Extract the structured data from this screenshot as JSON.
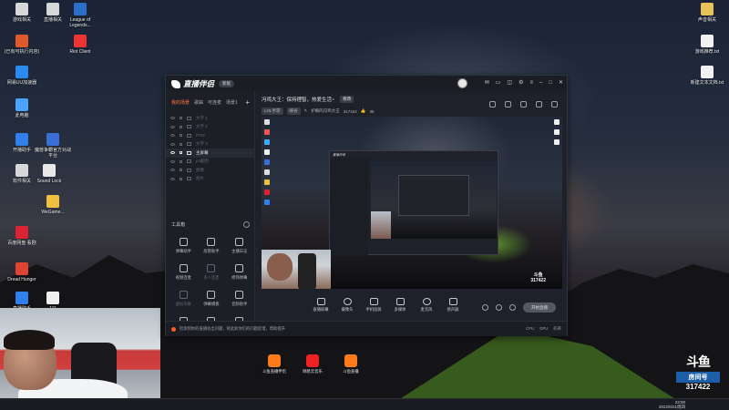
{
  "desktop_icons_left": [
    {
      "label": "游戏相关",
      "color": "#d8d8d8"
    },
    {
      "label": "直播相关",
      "color": "#d8d8d8"
    },
    {
      "label": "League of Legends...",
      "color": "#2a6fc9"
    },
    {
      "label": "(已有可执行内容)",
      "color": "#e05a2b"
    },
    {
      "label": "Riot Client",
      "color": "#e33"
    },
    {
      "label": "网易UU加速器",
      "color": "#2b8bf0"
    },
    {
      "label": "此电脑",
      "color": "#4aa3ff"
    },
    {
      "label": "开播助手",
      "color": "#2f80ed"
    },
    {
      "label": "魔兽争霸官方对战平台",
      "color": "#3a6fd8"
    },
    {
      "label": "软件相关",
      "color": "#d8d8d8"
    },
    {
      "label": "Sound Lock",
      "color": "#e8e8e8"
    },
    {
      "label": "WeGame...",
      "color": "#f0c040"
    },
    {
      "label": "百度网盘 看剧",
      "color": "#d23"
    },
    {
      "label": "Dread Hunger",
      "color": "#d43"
    },
    {
      "label": "直播助手",
      "color": "#2f80ed"
    },
    {
      "label": "111",
      "color": "#eee"
    }
  ],
  "desktop_icons_right": [
    {
      "label": "声音相关"
    },
    {
      "label": "游戏推荐.txt"
    },
    {
      "label": "新建文本文档.txt"
    }
  ],
  "app": {
    "name": "直播伴侣",
    "version_badge": "新版",
    "left_tabs": [
      "我的场景",
      "歌曲",
      "可连麦",
      "场景1"
    ],
    "scenes": [
      {
        "label": "文字 1",
        "selected": false
      },
      {
        "label": "文字 2",
        "selected": false
      },
      {
        "label": "RTM",
        "selected": false
      },
      {
        "label": "文字 3",
        "selected": false
      },
      {
        "label": "主屏幕",
        "selected": true
      },
      {
        "label": "ps截图",
        "selected": false
      },
      {
        "label": "图像",
        "selected": false
      },
      {
        "label": "图片",
        "selected": false
      }
    ],
    "tools_header": "工具箱",
    "tools": [
      {
        "label": "弹幕助手",
        "dim": false
      },
      {
        "label": "房管助手",
        "dim": false
      },
      {
        "label": "主播日志",
        "dim": false
      },
      {
        "label": "视频连麦",
        "dim": false
      },
      {
        "label": "多人连麦",
        "dim": true
      },
      {
        "label": "修饰弹幕",
        "dim": false
      },
      {
        "label": "虚拟形象",
        "dim": true
      },
      {
        "label": "弹幕模板",
        "dim": false
      },
      {
        "label": "音频助手",
        "dim": false
      },
      {
        "label": "PK",
        "dim": false
      },
      {
        "label": "",
        "dim": false
      },
      {
        "label": "",
        "dim": false
      }
    ],
    "stream": {
      "title": "冯鸡大王：保持理智，热爱生活~",
      "edit": "修改",
      "category": "LOL手游",
      "subcategory": "峡谷",
      "streamer": "护眼的冯鸡大王",
      "room_id": "317422",
      "likes": "38"
    },
    "bottom_buttons": [
      {
        "label": "直播屏幕"
      },
      {
        "label": "摄像头"
      },
      {
        "label": "手机投屏"
      },
      {
        "label": "多媒体"
      },
      {
        "label": "麦克风"
      },
      {
        "label": "扬声器"
      }
    ],
    "start_button": "开始直播",
    "status_text": "检测到你的直播会出问题，将此处你们的问题反馈，帮助提升",
    "status_right": [
      "CPU",
      "GPU",
      "码率"
    ]
  },
  "shortcuts": [
    {
      "label": "斗鱼直播伴侣",
      "color": "#ff7a1a"
    },
    {
      "label": "网易云音乐",
      "color": "#e22"
    },
    {
      "label": "斗鱼直播",
      "color": "#ff7a1a"
    }
  ],
  "watermark": {
    "site": "斗鱼",
    "room_label": "房间号",
    "room_number": "317422"
  },
  "tray": {
    "time": "23:00",
    "date": "2022/6/21周四"
  }
}
